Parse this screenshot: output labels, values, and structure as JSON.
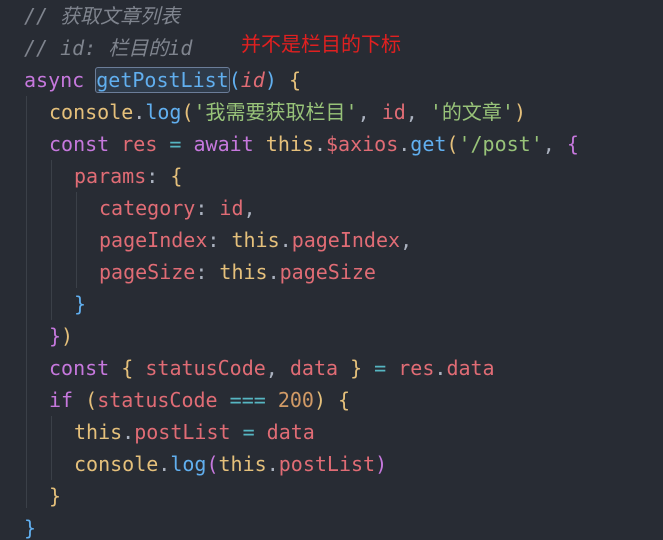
{
  "annotation": "并不是栏目的下标",
  "code": {
    "l1_comment": "// 获取文章列表",
    "l2_comment": "// id: 栏目的id",
    "l3_async": "async",
    "l3_fn": "getPostList",
    "l3_param": "id",
    "l4_console": "console",
    "l4_log": "log",
    "l4_str1": "'我需要获取栏目'",
    "l4_id": "id",
    "l4_str2": "'的文章'",
    "l5_const": "const",
    "l5_res": "res",
    "l5_await": "await",
    "l5_this": "this",
    "l5_axios": "$axios",
    "l5_get": "get",
    "l5_url": "'/post'",
    "l6_params": "params",
    "l7_category": "category",
    "l7_id": "id",
    "l8_pageIndex": "pageIndex",
    "l8_this": "this",
    "l8_pageIndexVal": "pageIndex",
    "l9_pageSize": "pageSize",
    "l9_this": "this",
    "l9_pageSizeVal": "pageSize",
    "l12_const": "const",
    "l12_statusCode": "statusCode",
    "l12_data": "data",
    "l12_res": "res",
    "l12_resData": "data",
    "l13_if": "if",
    "l13_statusCode": "statusCode",
    "l13_num": "200",
    "l14_this": "this",
    "l14_postList": "postList",
    "l14_data": "data",
    "l15_console": "console",
    "l15_log": "log",
    "l15_this": "this",
    "l15_postList": "postList"
  }
}
